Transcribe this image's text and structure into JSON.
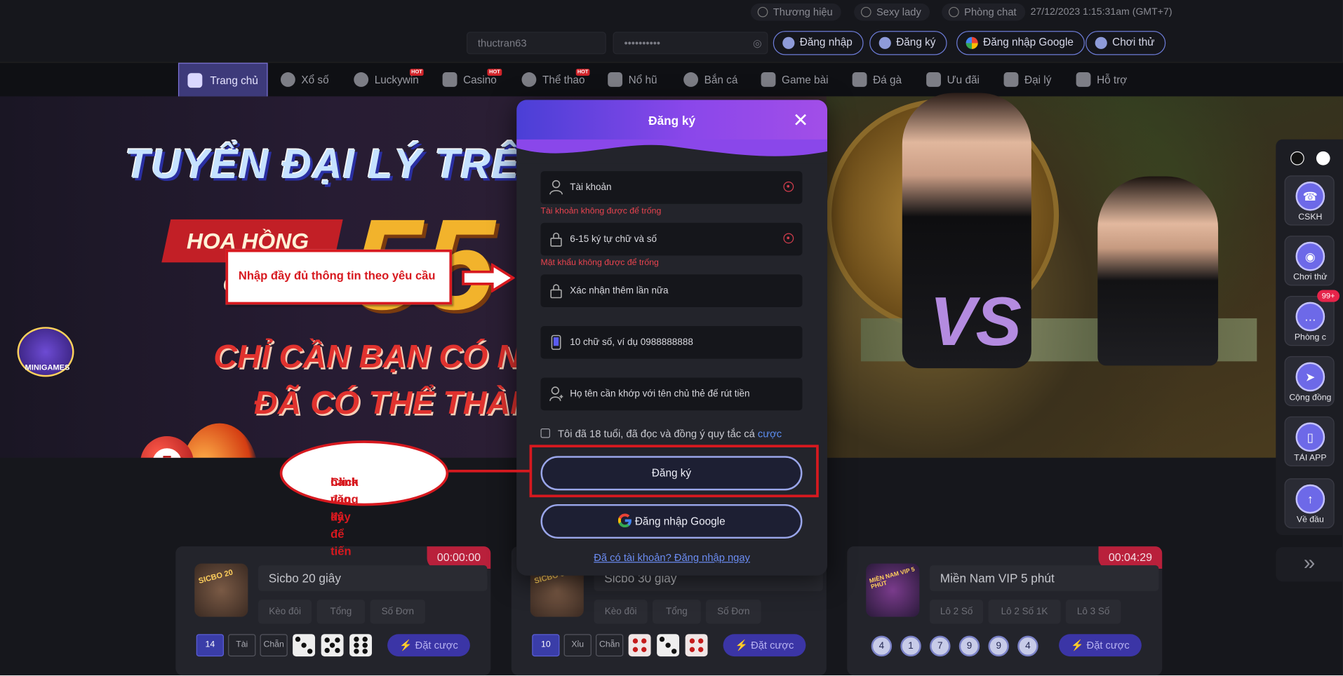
{
  "topbar": {
    "items": [
      "Thương hiệu",
      "Sexy lady",
      "Phòng chat"
    ],
    "datetime": "27/12/2023 1:15:31am",
    "timezone": "(GMT+7)"
  },
  "login": {
    "username_value": "thuctran63",
    "password_value": "••••••••••",
    "buttons": [
      "Đăng nhập",
      "Đăng ký",
      "Đăng nhập Google",
      "Chơi thử"
    ]
  },
  "nav": {
    "items": [
      {
        "label": "Trang chủ",
        "hot": ""
      },
      {
        "label": "Xổ số",
        "hot": ""
      },
      {
        "label": "Luckywin",
        "hot": "HOT"
      },
      {
        "label": "Casino",
        "hot": "HOT"
      },
      {
        "label": "Thể thao",
        "hot": "HOT"
      },
      {
        "label": "Nổ hũ",
        "hot": ""
      },
      {
        "label": "Bắn cá",
        "hot": ""
      },
      {
        "label": "Game bài",
        "hot": ""
      },
      {
        "label": "Đá gà",
        "hot": ""
      },
      {
        "label": "Ưu đãi",
        "hot": ""
      },
      {
        "label": "Đại lý",
        "hot": ""
      },
      {
        "label": "Hỗ trợ",
        "hot": ""
      }
    ]
  },
  "banner": {
    "title": "TUYỂN ĐẠI LÝ TRÊN TO",
    "tag": "HOA HỒNG CAO",
    "big": "55",
    "line1": "CHỈ CẦN BẠN CÓ NGUỒN LỰC, CÓ",
    "line2": "ĐÃ CÓ THỂ THÀNH SỰ T",
    "ball": "5",
    "logo": "MINIGAMES",
    "vs": "VS"
  },
  "games": [
    {
      "name": "Sicbo 20 giây",
      "timer": "00:00:00",
      "thumb": "SICBO 20",
      "options": [
        "Kèo đôi",
        "Tổng",
        "Số Đơn"
      ],
      "result": [
        "14",
        "Tài",
        "Chẵn"
      ],
      "bet": "Đặt cược"
    },
    {
      "name": "Sicbo 30 giây",
      "timer": "",
      "thumb": "SICBO 30",
      "options": [
        "Kèo đôi",
        "Tổng",
        "Số Đơn"
      ],
      "result": [
        "10",
        "Xỉu",
        "Chẵn"
      ],
      "bet": "Đặt cược"
    },
    {
      "name": "Miền Nam VIP 5 phút",
      "timer": "00:04:29",
      "thumb": "MIỀN NAM VIP 5 PHÚT",
      "options": [
        "Lô 2 Số",
        "Lô 2 Số 1K",
        "Lô 3 Số"
      ],
      "balls": [
        "4",
        "1",
        "7",
        "9",
        "9",
        "4"
      ],
      "bet": "Đặt cược"
    }
  ],
  "sidebar": {
    "items": [
      "CSKH",
      "Chơi thử",
      "Phòng c",
      "Cộng đồng",
      "TẢI APP",
      "Về đầu"
    ],
    "badge": "99+"
  },
  "modal": {
    "title": "Đăng ký",
    "fields": [
      {
        "placeholder": "Tài khoản"
      },
      {
        "placeholder": "6-15 ký tự chữ và số"
      },
      {
        "placeholder": "Xác nhận thêm lần nữa"
      },
      {
        "placeholder": "10 chữ số, ví dụ 0988888888"
      },
      {
        "placeholder": "Họ tên cần khớp với tên chủ thẻ để rút tiền"
      }
    ],
    "errors": [
      "Tài khoản không được để trống",
      "Mật khẩu không được để trống"
    ],
    "agree_text": "Tôi đã 18 tuổi, đã đọc và đồng ý quy tắc cá",
    "agree_link": "cược",
    "register_button": "Đăng ký",
    "google_button": "Đăng nhập Google",
    "login_link": "Đã có tài khoản? Đăng nhập ngay"
  },
  "annotations": {
    "note1": "Nhập đầy đủ thông tin theo yêu cầu",
    "note2_line1": "Click vào đây để tiến",
    "note2_line2": "hành đăng ký"
  },
  "colors": {
    "accent": "#6c7bd6",
    "annotation_red": "#d7191f",
    "error": "#e8434e",
    "link": "#5c8df0"
  }
}
